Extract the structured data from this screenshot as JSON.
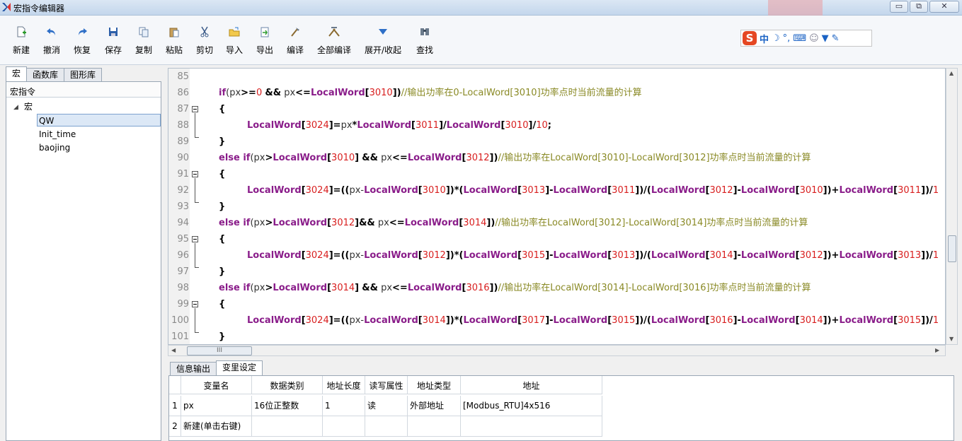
{
  "window": {
    "title": "宏指令编辑器",
    "min_label": "▭",
    "max_label": "⧉",
    "close_label": "✕"
  },
  "toolbar": {
    "buttons": [
      {
        "label": "新建",
        "icon": "new-file-icon"
      },
      {
        "label": "撤消",
        "icon": "undo-icon"
      },
      {
        "label": "恢复",
        "icon": "redo-icon"
      },
      {
        "label": "保存",
        "icon": "save-icon"
      },
      {
        "label": "复制",
        "icon": "copy-icon"
      },
      {
        "label": "粘贴",
        "icon": "paste-icon"
      },
      {
        "label": "剪切",
        "icon": "cut-icon"
      },
      {
        "label": "导入",
        "icon": "import-icon"
      },
      {
        "label": "导出",
        "icon": "export-icon"
      },
      {
        "label": "编译",
        "icon": "compile-icon"
      },
      {
        "label": "全部编译",
        "icon": "compile-all-icon"
      },
      {
        "label": "展开/收起",
        "icon": "expand-collapse-icon"
      },
      {
        "label": "查找",
        "icon": "find-icon"
      }
    ]
  },
  "ime": {
    "logo": "S",
    "mode": "中"
  },
  "left": {
    "tabs": [
      "宏",
      "函数库",
      "图形库"
    ],
    "header": "宏指令",
    "tree_root": "宏",
    "tree_items": [
      "QW",
      "Init_time",
      "baojing"
    ]
  },
  "editor": {
    "line_numbers": [
      "85",
      "86",
      "87",
      "88",
      "89",
      "90",
      "91",
      "92",
      "93",
      "94",
      "95",
      "96",
      "97",
      "98",
      "99",
      "100",
      "101"
    ]
  },
  "bottom": {
    "tabs": [
      "信息输出",
      "变里设定"
    ],
    "columns": [
      "变量名",
      "数据类别",
      "地址长度",
      "读写属性",
      "地址类型",
      "地址"
    ],
    "rows": [
      {
        "n": "1",
        "name": "px",
        "type": "16位正整数",
        "len": "1",
        "rw": "读",
        "addr_type": "外部地址",
        "addr": "[Modbus_RTU]4x516"
      },
      {
        "n": "2",
        "name": "新建(单击右键)",
        "type": "",
        "len": "",
        "rw": "",
        "addr_type": "",
        "addr": ""
      }
    ]
  }
}
